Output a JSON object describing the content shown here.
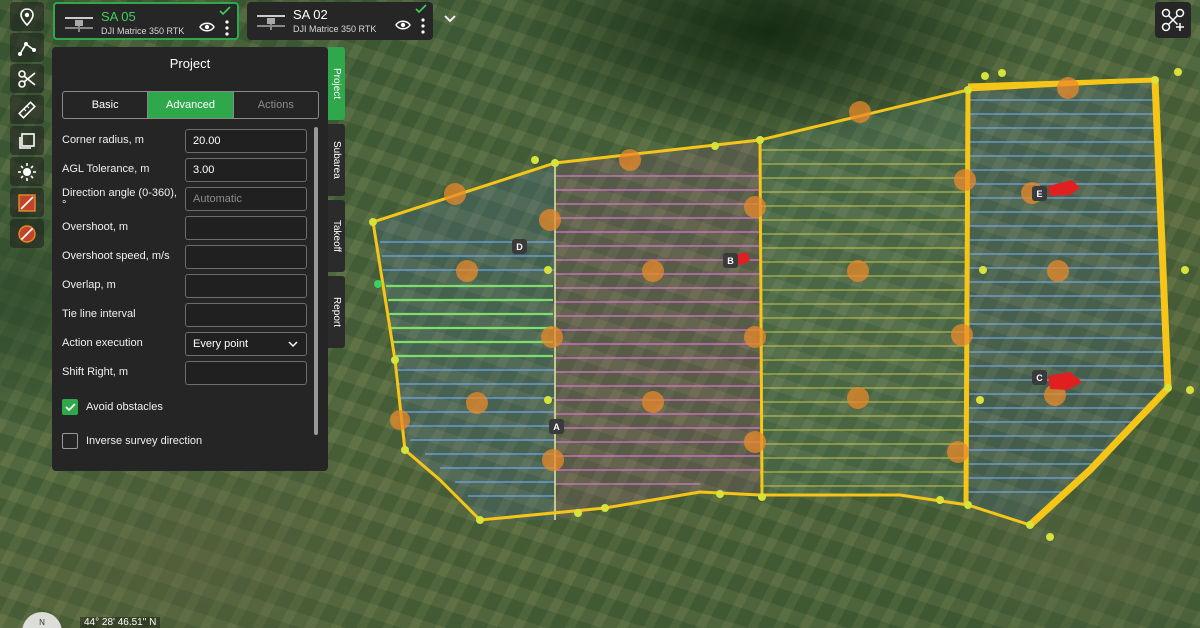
{
  "drones": [
    {
      "name": "SA 05",
      "model": "DJI Matrice 350 RTK",
      "active": true
    },
    {
      "name": "SA 02",
      "model": "DJI Matrice 350 RTK",
      "active": false
    }
  ],
  "toolbar": {
    "tools": [
      "map-pin-icon",
      "polyline-icon",
      "scissors-icon",
      "ruler-icon",
      "layers-icon",
      "sun-icon",
      "no-fly-zone-icon",
      "restricted-zone-icon"
    ]
  },
  "panel": {
    "title": "Project",
    "tabs": [
      {
        "label": "Basic",
        "active": false
      },
      {
        "label": "Advanced",
        "active": true
      },
      {
        "label": "Actions",
        "active": false
      }
    ],
    "fields": {
      "corner_radius": {
        "label": "Corner radius, m",
        "value": "20.00"
      },
      "agl_tolerance": {
        "label": "AGL Tolerance, m",
        "value": "3.00"
      },
      "direction_angle": {
        "label": "Direction angle (0-360), °",
        "placeholder": "Automatic"
      },
      "overshoot": {
        "label": "Overshoot, m",
        "value": ""
      },
      "overshoot_speed": {
        "label": "Overshoot speed, m/s",
        "value": ""
      },
      "overlap": {
        "label": "Overlap, m",
        "value": ""
      },
      "tie_line_interval": {
        "label": "Tie line interval",
        "value": ""
      },
      "action_execution": {
        "label": "Action execution",
        "value": "Every point"
      },
      "shift_right": {
        "label": "Shift Right, m",
        "value": ""
      }
    },
    "avoid_obstacles": {
      "label": "Avoid obstacles",
      "checked": true
    },
    "inverse_survey": {
      "label": "Inverse survey direction",
      "checked": false
    }
  },
  "side_tabs": [
    {
      "label": "Project",
      "active": true
    },
    {
      "label": "Subarea",
      "active": false
    },
    {
      "label": "Takeoff",
      "active": false
    },
    {
      "label": "Report",
      "active": false
    }
  ],
  "map": {
    "markers": [
      "A",
      "B",
      "C",
      "D",
      "E"
    ],
    "compass_label": "N",
    "coordinates": "44° 28' 46.51\" N"
  },
  "colors": {
    "accent": "#2ea84a",
    "boundary": "#f5c518",
    "waypoint": "#e8892a"
  }
}
